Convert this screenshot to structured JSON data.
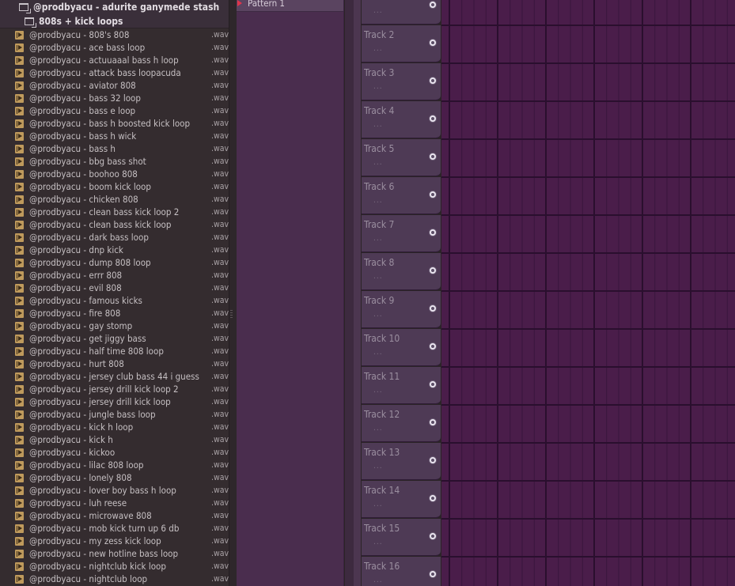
{
  "browser": {
    "root_folder": "@prodbyacu - adurite ganymede stash",
    "sub_folder": "808s + kick loops",
    "files": [
      {
        "name": "@prodbyacu - 808's 808",
        "ext": ".wav"
      },
      {
        "name": "@prodbyacu - ace bass loop",
        "ext": ".wav"
      },
      {
        "name": "@prodbyacu - actuuaaal bass h loop",
        "ext": ".wav"
      },
      {
        "name": "@prodbyacu - attack bass loopacuda",
        "ext": ".wav"
      },
      {
        "name": "@prodbyacu - aviator 808",
        "ext": ".wav"
      },
      {
        "name": "@prodbyacu - bass 32 loop",
        "ext": ".wav"
      },
      {
        "name": "@prodbyacu - bass e loop",
        "ext": ".wav"
      },
      {
        "name": "@prodbyacu - bass h boosted kick loop",
        "ext": ".wav"
      },
      {
        "name": "@prodbyacu - bass h wick",
        "ext": ".wav"
      },
      {
        "name": "@prodbyacu - bass h",
        "ext": ".wav"
      },
      {
        "name": "@prodbyacu - bbg bass shot",
        "ext": ".wav"
      },
      {
        "name": "@prodbyacu - boohoo 808",
        "ext": ".wav"
      },
      {
        "name": "@prodbyacu - boom kick loop",
        "ext": ".wav"
      },
      {
        "name": "@prodbyacu - chicken 808",
        "ext": ".wav"
      },
      {
        "name": "@prodbyacu - clean bass kick loop 2",
        "ext": ".wav"
      },
      {
        "name": "@prodbyacu - clean bass kick loop",
        "ext": ".wav"
      },
      {
        "name": "@prodbyacu - dark bass loop",
        "ext": ".wav"
      },
      {
        "name": "@prodbyacu - dnp kick",
        "ext": ".wav"
      },
      {
        "name": "@prodbyacu - dump 808 loop",
        "ext": ".wav"
      },
      {
        "name": "@prodbyacu - errr 808",
        "ext": ".wav"
      },
      {
        "name": "@prodbyacu - evil 808",
        "ext": ".wav"
      },
      {
        "name": "@prodbyacu - famous kicks",
        "ext": ".wav"
      },
      {
        "name": "@prodbyacu - fire 808",
        "ext": ".wav"
      },
      {
        "name": "@prodbyacu - gay stomp",
        "ext": ".wav"
      },
      {
        "name": "@prodbyacu - get jiggy bass",
        "ext": ".wav"
      },
      {
        "name": "@prodbyacu - half time 808 loop",
        "ext": ".wav"
      },
      {
        "name": "@prodbyacu - hurt 808",
        "ext": ".wav"
      },
      {
        "name": "@prodbyacu - jersey club bass 44 i guess",
        "ext": ".wav"
      },
      {
        "name": "@prodbyacu - jersey drill kick loop 2",
        "ext": ".wav"
      },
      {
        "name": "@prodbyacu - jersey drill kick loop",
        "ext": ".wav"
      },
      {
        "name": "@prodbyacu - jungle bass loop",
        "ext": ".wav"
      },
      {
        "name": "@prodbyacu - kick h loop",
        "ext": ".wav"
      },
      {
        "name": "@prodbyacu - kick h",
        "ext": ".wav"
      },
      {
        "name": "@prodbyacu - kickoo",
        "ext": ".wav"
      },
      {
        "name": "@prodbyacu - lilac 808 loop",
        "ext": ".wav"
      },
      {
        "name": "@prodbyacu - lonely 808",
        "ext": ".wav"
      },
      {
        "name": "@prodbyacu - lover boy bass h loop",
        "ext": ".wav"
      },
      {
        "name": "@prodbyacu - luh reese",
        "ext": ".wav"
      },
      {
        "name": "@prodbyacu - microwave 808",
        "ext": ".wav"
      },
      {
        "name": "@prodbyacu - mob kick turn up 6 db",
        "ext": ".wav"
      },
      {
        "name": "@prodbyacu - my zess kick loop",
        "ext": ".wav"
      },
      {
        "name": "@prodbyacu - new hotline bass loop",
        "ext": ".wav"
      },
      {
        "name": "@prodbyacu - nightclub kick loop",
        "ext": ".wav"
      },
      {
        "name": "@prodbyacu - nightclub loop",
        "ext": ".wav"
      }
    ]
  },
  "pattern": {
    "label": "Pattern 1"
  },
  "tracks": [
    {
      "name": "",
      "dots": "..."
    },
    {
      "name": "Track 2",
      "dots": "..."
    },
    {
      "name": "Track 3",
      "dots": "..."
    },
    {
      "name": "Track 4",
      "dots": "..."
    },
    {
      "name": "Track 5",
      "dots": "..."
    },
    {
      "name": "Track 6",
      "dots": "..."
    },
    {
      "name": "Track 7",
      "dots": "..."
    },
    {
      "name": "Track 8",
      "dots": "..."
    },
    {
      "name": "Track 9",
      "dots": "..."
    },
    {
      "name": "Track 10",
      "dots": "..."
    },
    {
      "name": "Track 11",
      "dots": "..."
    },
    {
      "name": "Track 12",
      "dots": "..."
    },
    {
      "name": "Track 13",
      "dots": "..."
    },
    {
      "name": "Track 14",
      "dots": "..."
    },
    {
      "name": "Track 15",
      "dots": "..."
    },
    {
      "name": "Track 16",
      "dots": "..."
    }
  ],
  "colors": {
    "pattern_marker": "#e0344a",
    "playlist_bg": "#4a1d4a",
    "track_header": "#4e3a55",
    "file_icon": "#bf9a5c"
  }
}
